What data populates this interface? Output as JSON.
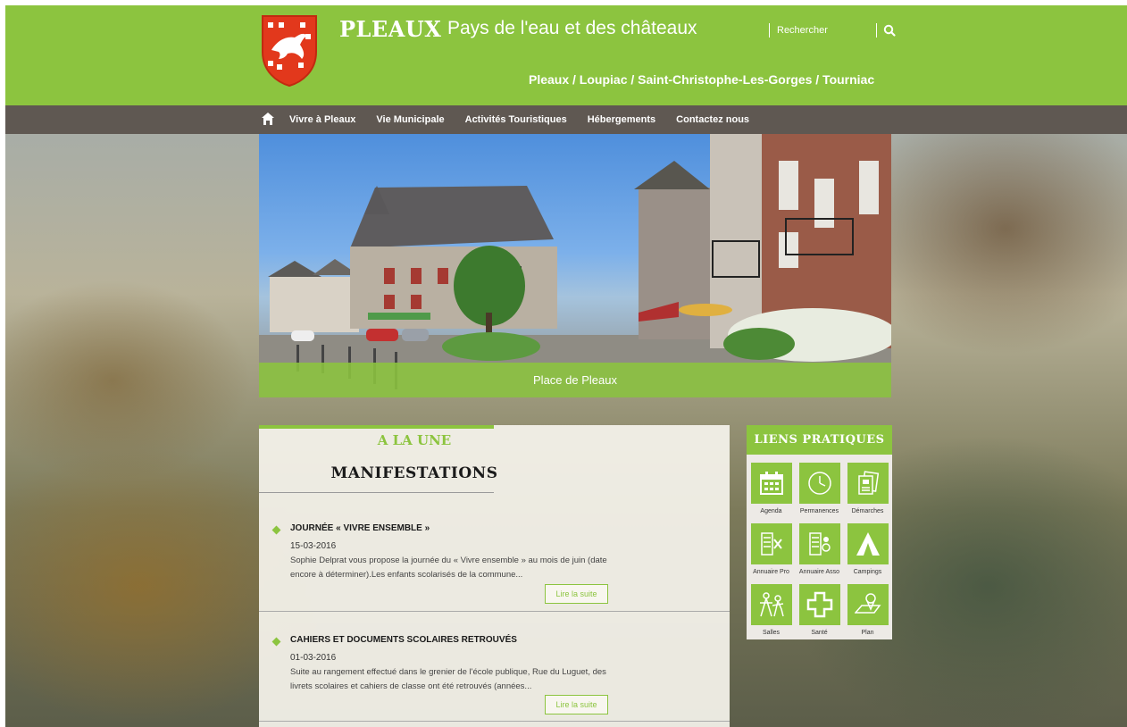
{
  "header": {
    "site_title": "PLEAUX",
    "tagline": "Pays de l'eau et des châteaux",
    "search_placeholder": "Rechercher",
    "communes": "Pleaux / Loupiac / Saint-Christophe-Les-Gorges / Tourniac"
  },
  "nav": {
    "items": [
      "Vivre à Pleaux",
      "Vie Municipale",
      "Activités Touristiques",
      "Hébergements",
      "Contactez nous"
    ]
  },
  "hero": {
    "caption": "Place de Pleaux"
  },
  "news": {
    "kicker": "A LA UNE",
    "section_title": "MANIFESTATIONS",
    "read_more": "Lire la suite",
    "articles": [
      {
        "title": "JOURNÉE « VIVRE ENSEMBLE »",
        "date": "15-03-2016",
        "excerpt": "Sophie Delprat vous propose la journée du « Vivre ensemble » au mois de juin (date encore à déterminer).Les enfants scolarisés de la commune..."
      },
      {
        "title": "CAHIERS ET DOCUMENTS SCOLAIRES RETROUVÉS",
        "date": "01-03-2016",
        "excerpt": "Suite au rangement effectué dans le grenier de l'école publique, Rue du Luguet, des livrets scolaires et cahiers de classe ont été retrouvés (années..."
      }
    ]
  },
  "links": {
    "title": "LIENS PRATIQUES",
    "tiles": [
      {
        "label": "Agenda",
        "icon": "calendar-icon"
      },
      {
        "label": "Permanences",
        "icon": "clock-icon"
      },
      {
        "label": "Démarches",
        "icon": "documents-icon"
      },
      {
        "label": "Annuaire Pro",
        "icon": "business-directory-icon"
      },
      {
        "label": "Annuaire Asso",
        "icon": "association-directory-icon"
      },
      {
        "label": "Campings",
        "icon": "tent-icon"
      },
      {
        "label": "Salles",
        "icon": "hall-icon"
      },
      {
        "label": "Santé",
        "icon": "health-cross-icon"
      },
      {
        "label": "Plan",
        "icon": "map-pin-icon"
      }
    ]
  },
  "colors": {
    "brand_green": "#8cc43f",
    "nav_bg": "#5f5852",
    "crest_red": "#e2381c"
  }
}
